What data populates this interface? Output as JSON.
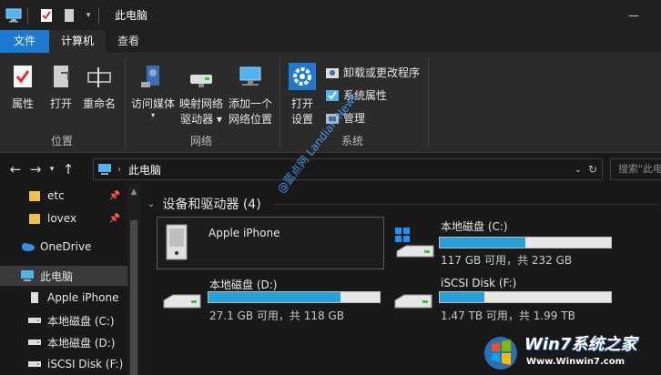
{
  "window": {
    "title": "此电脑",
    "controls": {
      "minimize": "—",
      "maximize": "☐",
      "close": "✕"
    }
  },
  "ribbon_tabs": [
    {
      "label": "文件"
    },
    {
      "label": "计算机"
    },
    {
      "label": "查看"
    }
  ],
  "ribbon": {
    "location_group": {
      "label": "位置",
      "buttons": [
        {
          "label": "属性",
          "icon": "properties-icon"
        },
        {
          "label": "打开",
          "icon": "open-icon"
        },
        {
          "label": "重命名",
          "icon": "rename-icon"
        }
      ]
    },
    "network_group": {
      "label": "网络",
      "buttons": [
        {
          "label": "访问媒体",
          "icon": "media-icon"
        },
        {
          "label": "映射网络",
          "label2": "驱动器",
          "icon": "map-drive-icon"
        },
        {
          "label": "添加一个",
          "label2": "网络位置",
          "icon": "network-location-icon"
        }
      ]
    },
    "system_group": {
      "label": "系统",
      "buttons": [
        {
          "label": "打开",
          "label2": "设置",
          "icon": "settings-icon"
        }
      ],
      "small_buttons": [
        {
          "label": "卸载或更改程序",
          "icon": "uninstall-icon"
        },
        {
          "label": "系统属性",
          "icon": "system-properties-icon"
        },
        {
          "label": "管理",
          "icon": "manage-icon"
        }
      ]
    }
  },
  "address": {
    "path": "此电脑",
    "search_placeholder": "搜索\"此电脑\""
  },
  "sidebar": {
    "items": [
      {
        "label": "etc",
        "icon": "folder-icon",
        "pinned": true
      },
      {
        "label": "lovex",
        "icon": "folder-icon",
        "pinned": true
      },
      {
        "label": "OneDrive",
        "icon": "onedrive-icon"
      },
      {
        "label": "此电脑",
        "icon": "computer-icon",
        "selected": true
      },
      {
        "label": "Apple iPhone",
        "icon": "phone-icon"
      },
      {
        "label": "本地磁盘 (C:)",
        "icon": "drive-icon"
      },
      {
        "label": "本地磁盘 (D:)",
        "icon": "drive-icon"
      },
      {
        "label": "iSCSI Disk (F:)",
        "icon": "drive-icon"
      }
    ]
  },
  "content": {
    "section_title": "设备和驱动器 (4)",
    "devices": [
      {
        "name": "Apple iPhone",
        "icon": "phone-device-icon"
      },
      {
        "name": "本地磁盘 (C:)",
        "usage_fraction": 0.5,
        "sub": "117 GB 可用，共 232 GB",
        "icon": "windows-drive-icon"
      },
      {
        "name": "本地磁盘 (D:)",
        "usage_fraction": 0.77,
        "sub": "27.1 GB 可用，共 118 GB",
        "icon": "drive-icon"
      },
      {
        "name": "iSCSI Disk (F:)",
        "usage_fraction": 0.26,
        "sub": "1.47 TB 可用，共 1.99 TB",
        "icon": "drive-icon"
      }
    ]
  },
  "watermarks": {
    "diagonal": "@蓝点网 Landian.News",
    "logo_text": "Win7系统之家",
    "logo_url_text": "Www.Winwin7.com"
  },
  "colors": {
    "accent": "#1e7ad1",
    "bar_fill": "#26a0da",
    "background": "#191919",
    "ribbon": "#2b2b2b"
  }
}
